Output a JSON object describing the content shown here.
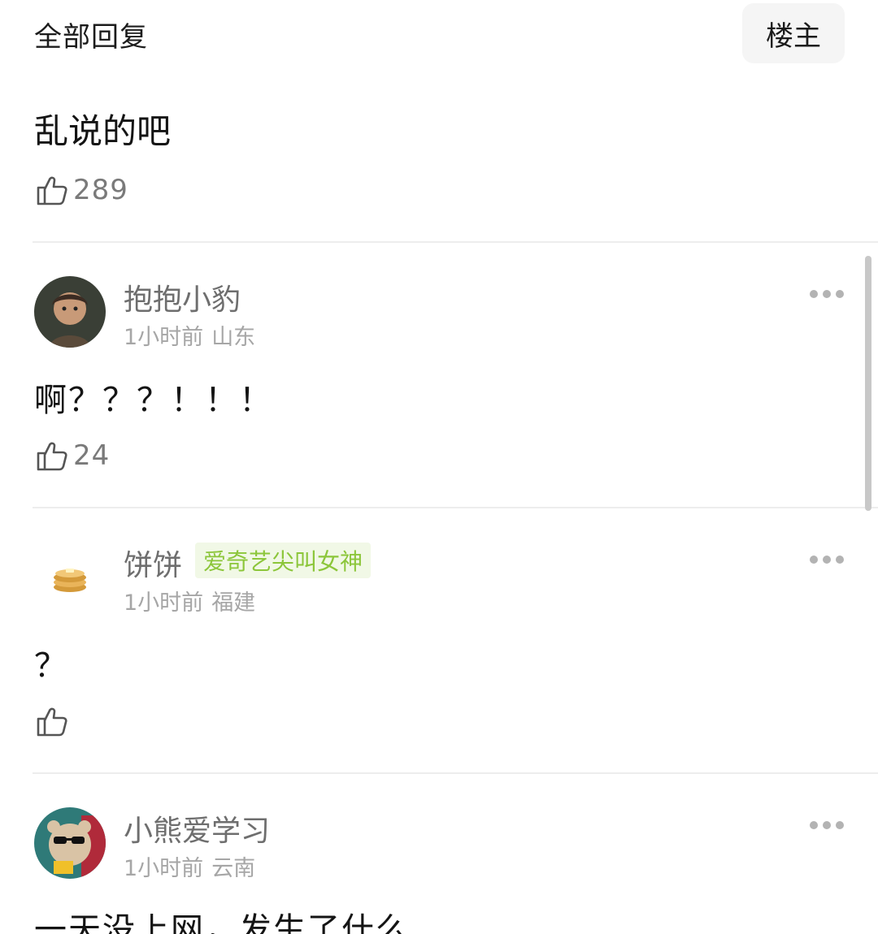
{
  "header": {
    "title": "全部回复",
    "op_button": "楼主"
  },
  "main_post": {
    "text": "乱说的吧",
    "likes": "289"
  },
  "comments": [
    {
      "username": "抱抱小豹",
      "time": "1小时前",
      "location": "山东",
      "badge": "",
      "text": "啊？？？！！！",
      "likes": "24"
    },
    {
      "username": "饼饼",
      "time": "1小时前",
      "location": "福建",
      "badge": "爱奇艺尖叫女神",
      "text": "？",
      "likes": ""
    },
    {
      "username": "小熊爱学习",
      "time": "1小时前",
      "location": "云南",
      "badge": "",
      "text": "一天没上网，发生了什么",
      "likes": ""
    }
  ],
  "colors": {
    "badge_text": "#8cc63a",
    "badge_bg": "#f1f8e6",
    "secondary_text": "#a6a6a6"
  }
}
